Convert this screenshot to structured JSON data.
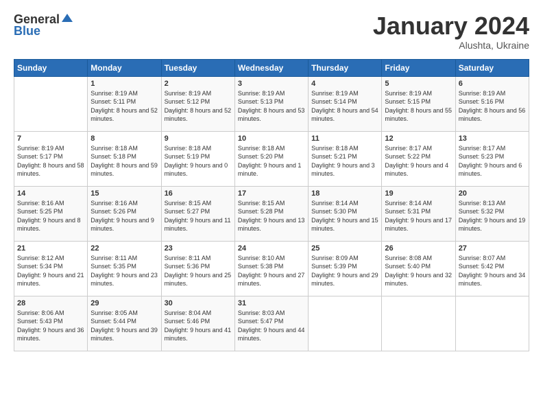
{
  "header": {
    "logo_general": "General",
    "logo_blue": "Blue",
    "month": "January 2024",
    "location": "Alushta, Ukraine"
  },
  "days_of_week": [
    "Sunday",
    "Monday",
    "Tuesday",
    "Wednesday",
    "Thursday",
    "Friday",
    "Saturday"
  ],
  "weeks": [
    [
      {
        "day": "",
        "sunrise": "",
        "sunset": "",
        "daylight": ""
      },
      {
        "day": "1",
        "sunrise": "Sunrise: 8:19 AM",
        "sunset": "Sunset: 5:11 PM",
        "daylight": "Daylight: 8 hours and 52 minutes."
      },
      {
        "day": "2",
        "sunrise": "Sunrise: 8:19 AM",
        "sunset": "Sunset: 5:12 PM",
        "daylight": "Daylight: 8 hours and 52 minutes."
      },
      {
        "day": "3",
        "sunrise": "Sunrise: 8:19 AM",
        "sunset": "Sunset: 5:13 PM",
        "daylight": "Daylight: 8 hours and 53 minutes."
      },
      {
        "day": "4",
        "sunrise": "Sunrise: 8:19 AM",
        "sunset": "Sunset: 5:14 PM",
        "daylight": "Daylight: 8 hours and 54 minutes."
      },
      {
        "day": "5",
        "sunrise": "Sunrise: 8:19 AM",
        "sunset": "Sunset: 5:15 PM",
        "daylight": "Daylight: 8 hours and 55 minutes."
      },
      {
        "day": "6",
        "sunrise": "Sunrise: 8:19 AM",
        "sunset": "Sunset: 5:16 PM",
        "daylight": "Daylight: 8 hours and 56 minutes."
      }
    ],
    [
      {
        "day": "7",
        "sunrise": "Sunrise: 8:19 AM",
        "sunset": "Sunset: 5:17 PM",
        "daylight": "Daylight: 8 hours and 58 minutes."
      },
      {
        "day": "8",
        "sunrise": "Sunrise: 8:18 AM",
        "sunset": "Sunset: 5:18 PM",
        "daylight": "Daylight: 8 hours and 59 minutes."
      },
      {
        "day": "9",
        "sunrise": "Sunrise: 8:18 AM",
        "sunset": "Sunset: 5:19 PM",
        "daylight": "Daylight: 9 hours and 0 minutes."
      },
      {
        "day": "10",
        "sunrise": "Sunrise: 8:18 AM",
        "sunset": "Sunset: 5:20 PM",
        "daylight": "Daylight: 9 hours and 1 minute."
      },
      {
        "day": "11",
        "sunrise": "Sunrise: 8:18 AM",
        "sunset": "Sunset: 5:21 PM",
        "daylight": "Daylight: 9 hours and 3 minutes."
      },
      {
        "day": "12",
        "sunrise": "Sunrise: 8:17 AM",
        "sunset": "Sunset: 5:22 PM",
        "daylight": "Daylight: 9 hours and 4 minutes."
      },
      {
        "day": "13",
        "sunrise": "Sunrise: 8:17 AM",
        "sunset": "Sunset: 5:23 PM",
        "daylight": "Daylight: 9 hours and 6 minutes."
      }
    ],
    [
      {
        "day": "14",
        "sunrise": "Sunrise: 8:16 AM",
        "sunset": "Sunset: 5:25 PM",
        "daylight": "Daylight: 9 hours and 8 minutes."
      },
      {
        "day": "15",
        "sunrise": "Sunrise: 8:16 AM",
        "sunset": "Sunset: 5:26 PM",
        "daylight": "Daylight: 9 hours and 9 minutes."
      },
      {
        "day": "16",
        "sunrise": "Sunrise: 8:15 AM",
        "sunset": "Sunset: 5:27 PM",
        "daylight": "Daylight: 9 hours and 11 minutes."
      },
      {
        "day": "17",
        "sunrise": "Sunrise: 8:15 AM",
        "sunset": "Sunset: 5:28 PM",
        "daylight": "Daylight: 9 hours and 13 minutes."
      },
      {
        "day": "18",
        "sunrise": "Sunrise: 8:14 AM",
        "sunset": "Sunset: 5:30 PM",
        "daylight": "Daylight: 9 hours and 15 minutes."
      },
      {
        "day": "19",
        "sunrise": "Sunrise: 8:14 AM",
        "sunset": "Sunset: 5:31 PM",
        "daylight": "Daylight: 9 hours and 17 minutes."
      },
      {
        "day": "20",
        "sunrise": "Sunrise: 8:13 AM",
        "sunset": "Sunset: 5:32 PM",
        "daylight": "Daylight: 9 hours and 19 minutes."
      }
    ],
    [
      {
        "day": "21",
        "sunrise": "Sunrise: 8:12 AM",
        "sunset": "Sunset: 5:34 PM",
        "daylight": "Daylight: 9 hours and 21 minutes."
      },
      {
        "day": "22",
        "sunrise": "Sunrise: 8:11 AM",
        "sunset": "Sunset: 5:35 PM",
        "daylight": "Daylight: 9 hours and 23 minutes."
      },
      {
        "day": "23",
        "sunrise": "Sunrise: 8:11 AM",
        "sunset": "Sunset: 5:36 PM",
        "daylight": "Daylight: 9 hours and 25 minutes."
      },
      {
        "day": "24",
        "sunrise": "Sunrise: 8:10 AM",
        "sunset": "Sunset: 5:38 PM",
        "daylight": "Daylight: 9 hours and 27 minutes."
      },
      {
        "day": "25",
        "sunrise": "Sunrise: 8:09 AM",
        "sunset": "Sunset: 5:39 PM",
        "daylight": "Daylight: 9 hours and 29 minutes."
      },
      {
        "day": "26",
        "sunrise": "Sunrise: 8:08 AM",
        "sunset": "Sunset: 5:40 PM",
        "daylight": "Daylight: 9 hours and 32 minutes."
      },
      {
        "day": "27",
        "sunrise": "Sunrise: 8:07 AM",
        "sunset": "Sunset: 5:42 PM",
        "daylight": "Daylight: 9 hours and 34 minutes."
      }
    ],
    [
      {
        "day": "28",
        "sunrise": "Sunrise: 8:06 AM",
        "sunset": "Sunset: 5:43 PM",
        "daylight": "Daylight: 9 hours and 36 minutes."
      },
      {
        "day": "29",
        "sunrise": "Sunrise: 8:05 AM",
        "sunset": "Sunset: 5:44 PM",
        "daylight": "Daylight: 9 hours and 39 minutes."
      },
      {
        "day": "30",
        "sunrise": "Sunrise: 8:04 AM",
        "sunset": "Sunset: 5:46 PM",
        "daylight": "Daylight: 9 hours and 41 minutes."
      },
      {
        "day": "31",
        "sunrise": "Sunrise: 8:03 AM",
        "sunset": "Sunset: 5:47 PM",
        "daylight": "Daylight: 9 hours and 44 minutes."
      },
      {
        "day": "",
        "sunrise": "",
        "sunset": "",
        "daylight": ""
      },
      {
        "day": "",
        "sunrise": "",
        "sunset": "",
        "daylight": ""
      },
      {
        "day": "",
        "sunrise": "",
        "sunset": "",
        "daylight": ""
      }
    ]
  ]
}
